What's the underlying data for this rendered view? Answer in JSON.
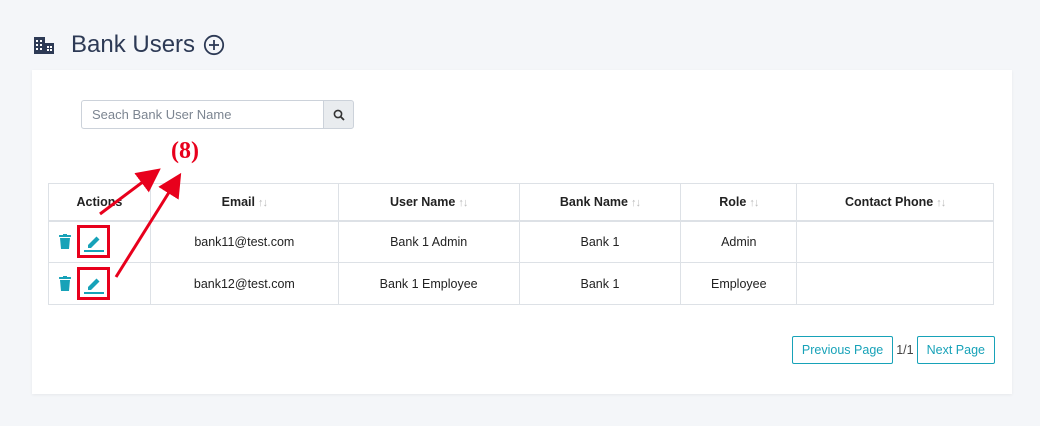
{
  "header": {
    "title": "Bank Users",
    "icon": "building-icon",
    "add_icon": "plus-circle-icon"
  },
  "search": {
    "placeholder": "Seach Bank User Name",
    "value": "",
    "button_icon": "search-icon"
  },
  "table": {
    "columns": [
      {
        "label": "Actions",
        "sortable": false
      },
      {
        "label": "Email",
        "sortable": true
      },
      {
        "label": "User Name",
        "sortable": true
      },
      {
        "label": "Bank Name",
        "sortable": true
      },
      {
        "label": "Role",
        "sortable": true
      },
      {
        "label": "Contact Phone",
        "sortable": true
      }
    ],
    "sort_glyph": "↑↓",
    "rows": [
      {
        "email": "bank11@test.com",
        "user_name": "Bank 1 Admin",
        "bank_name": "Bank 1",
        "role": "Admin",
        "contact_phone": ""
      },
      {
        "email": "bank12@test.com",
        "user_name": "Bank 1 Employee",
        "bank_name": "Bank 1",
        "role": "Employee",
        "contact_phone": ""
      }
    ]
  },
  "pagination": {
    "prev_label": "Previous Page",
    "page_info": "1/1",
    "next_label": "Next Page"
  },
  "annotation": {
    "label": "(8)",
    "color": "#e8001c"
  },
  "colors": {
    "accent": "#17a2b8",
    "title": "#2d3a55",
    "annotation": "#e8001c"
  }
}
